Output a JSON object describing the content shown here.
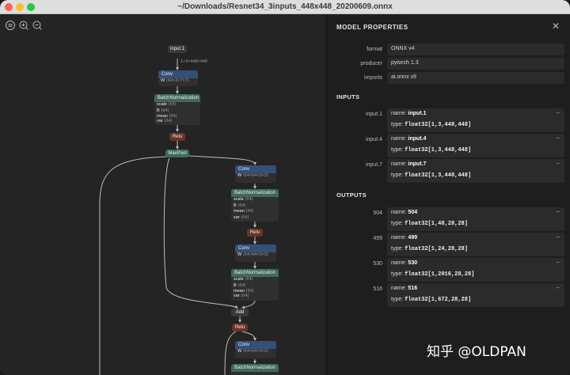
{
  "window": {
    "title": "~/Downloads/Resnet34_3inputs_448x448_20200609.onnx"
  },
  "toolbar": {
    "icons": [
      "sidebar-icon",
      "zoom-in-icon",
      "zoom-out-icon"
    ]
  },
  "graph": {
    "input": {
      "label": "input.1",
      "shape": "1×3×448×448"
    },
    "conv1": {
      "title": "Conv",
      "w_key": "W",
      "w_val": "⟨64×3×7×7⟩"
    },
    "bn1": {
      "title": "BatchNormalization",
      "rows": [
        {
          "k": "scale",
          "v": "⟨64⟩"
        },
        {
          "k": "B",
          "v": "⟨64⟩"
        },
        {
          "k": "mean",
          "v": "⟨64⟩"
        },
        {
          "k": "var",
          "v": "⟨64⟩"
        }
      ]
    },
    "relu1": "Relu",
    "maxpool": "MaxPool",
    "conv2": {
      "title": "Conv",
      "w_key": "W",
      "w_val": "⟨64×64×3×3⟩"
    },
    "bn2": {
      "title": "BatchNormalization",
      "rows": [
        {
          "k": "scale",
          "v": "⟨64⟩"
        },
        {
          "k": "B",
          "v": "⟨64⟩"
        },
        {
          "k": "mean",
          "v": "⟨64⟩"
        },
        {
          "k": "var",
          "v": "⟨64⟩"
        }
      ]
    },
    "relu2": "Relu",
    "conv3": {
      "title": "Conv",
      "w_key": "W",
      "w_val": "⟨64×64×3×3⟩"
    },
    "bn3": {
      "title": "BatchNormalization",
      "rows": [
        {
          "k": "scale",
          "v": "⟨64⟩"
        },
        {
          "k": "B",
          "v": "⟨64⟩"
        },
        {
          "k": "mean",
          "v": "⟨64⟩"
        },
        {
          "k": "var",
          "v": "⟨64⟩"
        }
      ]
    },
    "add": "Add",
    "relu3": "Relu",
    "conv4": {
      "title": "Conv",
      "w_key": "W",
      "w_val": "⟨64×64×3×3⟩"
    },
    "bn4": {
      "title": "BatchNormalization"
    }
  },
  "panel": {
    "title": "MODEL PROPERTIES",
    "close": "✕",
    "props": [
      {
        "label": "format",
        "value": "ONNX v4"
      },
      {
        "label": "producer",
        "value": "pytorch 1.3"
      },
      {
        "label": "imports",
        "value": "ai.onnx v9"
      }
    ],
    "inputs_title": "INPUTS",
    "inputs": [
      {
        "label": "input.1",
        "name": "input.1",
        "type": "float32[1,3,448,448]"
      },
      {
        "label": "input.4",
        "name": "input.4",
        "type": "float32[1,3,448,448]"
      },
      {
        "label": "input.7",
        "name": "input.7",
        "type": "float32[1,3,448,448]"
      }
    ],
    "outputs_title": "OUTPUTS",
    "outputs": [
      {
        "label": "504",
        "name": "504",
        "type": "float32[1,48,28,28]"
      },
      {
        "label": "499",
        "name": "499",
        "type": "float32[1,24,28,28]"
      },
      {
        "label": "530",
        "name": "530",
        "type": "float32[1,2016,28,28]"
      },
      {
        "label": "516",
        "name": "516",
        "type": "float32[1,672,28,28]"
      }
    ],
    "name_prefix": "name:",
    "type_prefix": "type:",
    "collapse": "–"
  },
  "watermark": "知乎 @OLDPAN",
  "colors": {
    "conv": "#33507a",
    "bn": "#3e6b57",
    "relu": "#6a3426",
    "bg": "#242424",
    "panel": "#1e1e1e"
  }
}
